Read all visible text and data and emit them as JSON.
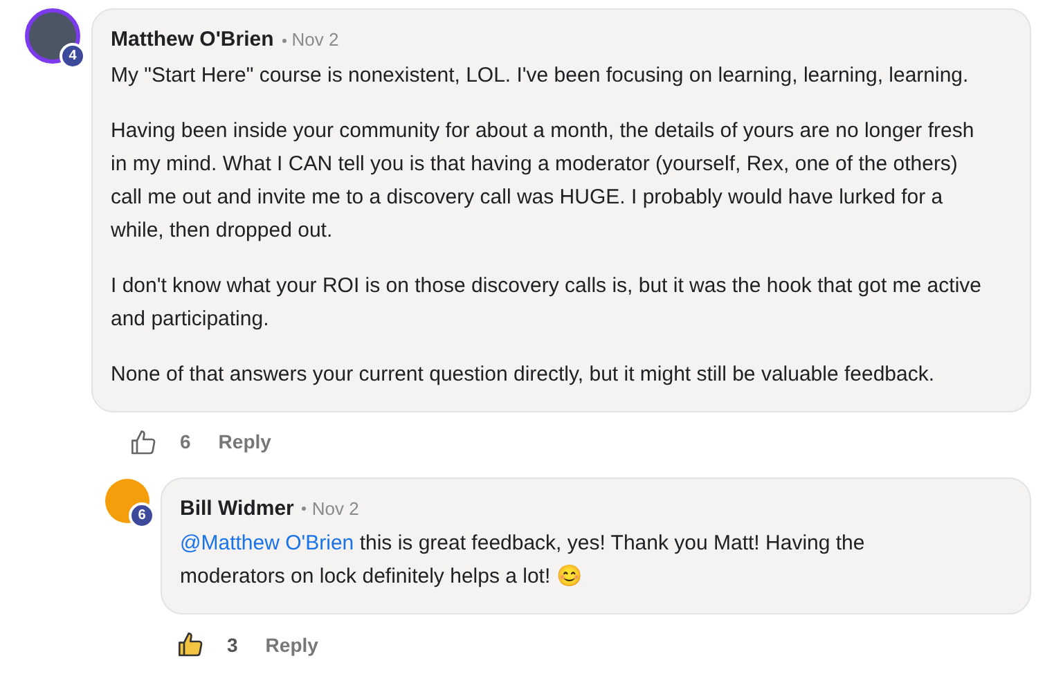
{
  "comments": [
    {
      "author": "Matthew O'Brien",
      "level_badge": "4",
      "date": "Nov 2",
      "paragraphs": [
        "My \"Start Here\" course is nonexistent, LOL. I've been focusing on learning, learning, learning.",
        "Having been inside your community for about a month, the details of yours are no longer fresh in my mind. What I CAN tell you is that having a moderator (yourself, Rex, one of the others) call me out and invite me to a discovery call was HUGE. I probably would have lurked for a while, then dropped out.",
        "I don't know what your ROI is on those discovery calls is, but it was the hook that got me active and participating.",
        "None of that answers your current question directly, but it might still be valuable feedback."
      ],
      "likes": "6",
      "liked": false,
      "reply_label": "Reply",
      "replies": [
        {
          "author": "Bill Widmer",
          "level_badge": "6",
          "date": "Nov 2",
          "mention": "@Matthew O'Brien",
          "paragraphs": [
            "this is great feedback, yes! Thank you Matt! Having the moderators on lock definitely helps a lot! 😊"
          ],
          "likes": "3",
          "liked": true,
          "reply_label": "Reply"
        }
      ]
    }
  ]
}
